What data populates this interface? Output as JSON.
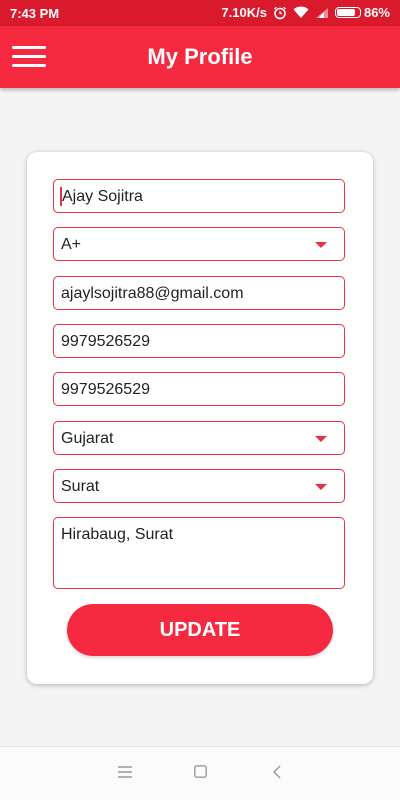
{
  "status_bar": {
    "time": "7:43 PM",
    "network_speed": "7.10K/s",
    "battery_percent": "86%",
    "battery_level": 0.86,
    "icons": [
      "alarm-icon",
      "wifi-icon",
      "signal-icon",
      "battery-icon"
    ]
  },
  "app_bar": {
    "title": "My Profile",
    "menu_icon": "hamburger-menu-icon"
  },
  "form": {
    "name": "Ajay Sojitra",
    "blood_group": "A+",
    "email": "ajaylsojitra88@gmail.com",
    "phone": "9979526529",
    "alt_phone": "9979526529",
    "state": "Gujarat",
    "city": "Surat",
    "address": "Hirabaug, Surat",
    "update_label": "UPDATE"
  },
  "nav_bar": {
    "icons": [
      "recents-icon",
      "home-icon",
      "back-icon"
    ]
  },
  "colors": {
    "primary": "#f5293f",
    "status_bar": "#d81a2c",
    "field_border": "#e8323f",
    "background": "#f4f4f4"
  }
}
